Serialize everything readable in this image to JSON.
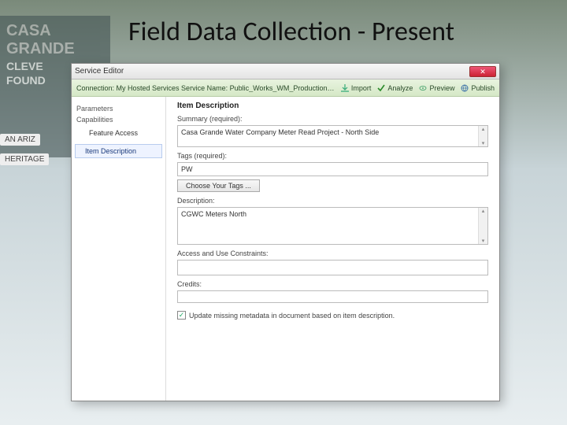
{
  "slide": {
    "title": "Field Data Collection - Present"
  },
  "background": {
    "sign_line1": "CASA GRANDE",
    "sign_line2": "CLEVE",
    "sign_line3": "FOUND",
    "tag1": "AN ARIZ",
    "tag2": "HERITAGE"
  },
  "window": {
    "title": "Service Editor",
    "close": "✕",
    "connection_line": "Connection: My Hosted Services   Service Name: Public_Works_WM_Production_N...",
    "toolbar": {
      "import": "Import",
      "analyze": "Analyze",
      "preview": "Preview",
      "publish": "Publish"
    },
    "sidebar": {
      "parameters": "Parameters",
      "capabilities": "Capabilities",
      "feature_access": "Feature Access",
      "item_description": "Item Description"
    },
    "main": {
      "heading": "Item Description",
      "summary_label": "Summary (required):",
      "summary_value": "Casa Grande Water Company Meter Read Project - North Side",
      "tags_label": "Tags (required):",
      "tags_value": "PW",
      "choose_tags": "Choose Your Tags ...",
      "description_label": "Description:",
      "description_value": "CGWC Meters North",
      "access_label": "Access and Use Constraints:",
      "access_value": "",
      "credits_label": "Credits:",
      "credits_value": "",
      "update_checkbox": "Update missing metadata in document based on item description."
    }
  }
}
